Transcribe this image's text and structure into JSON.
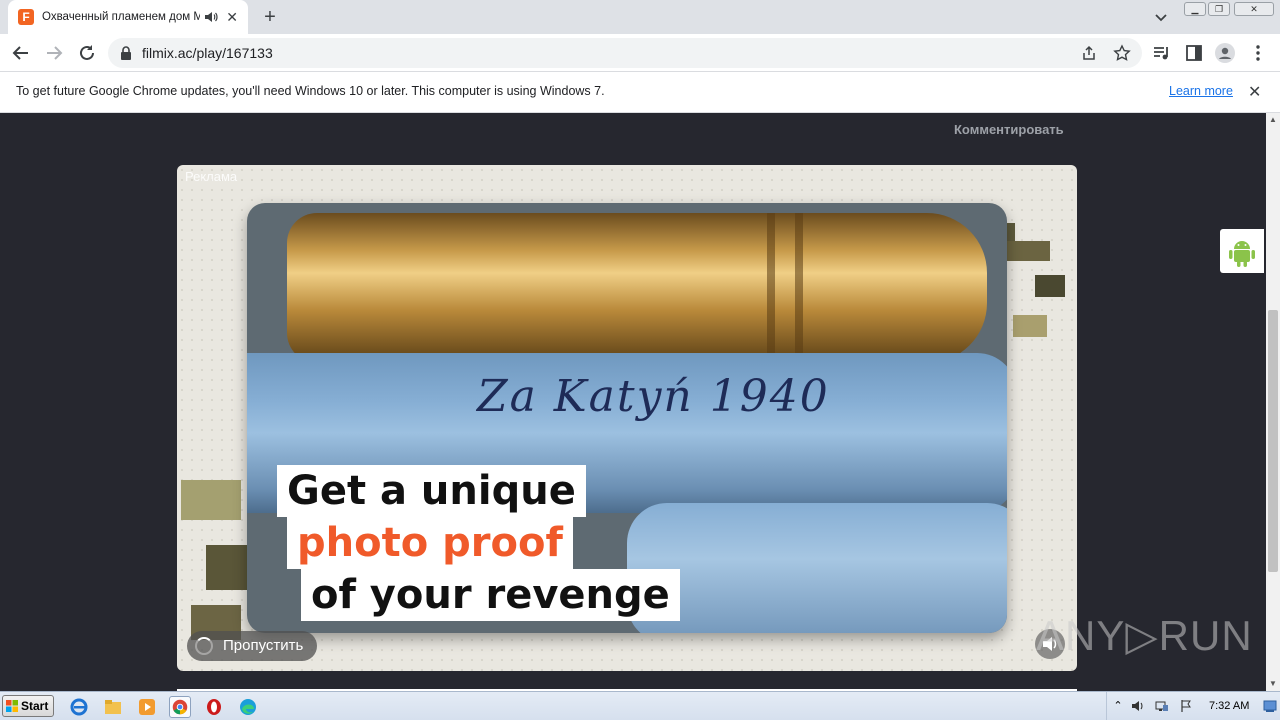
{
  "browser": {
    "tab": {
      "favicon_letter": "F",
      "title": "Охваченный пламенем дом Ма",
      "favicon_color": "#f26522"
    },
    "url": "filmix.ac/play/167133",
    "infobar": {
      "message": "To get future Google Chrome updates, you'll need Windows 10 or later. This computer is using Windows 7.",
      "link": "Learn more"
    }
  },
  "page": {
    "comment_link": "Комментировать",
    "ad": {
      "label": "Реклама",
      "scrawl": "Za Katyń 1940",
      "caption": [
        "Get a unique",
        "photo proof",
        "of your revenge"
      ],
      "caption_accent_color": "#f05a2a",
      "skip_label": "Пропустить"
    },
    "watermark": "ANY▷RUN"
  },
  "taskbar": {
    "start_label": "Start",
    "clock": "7:32 AM"
  }
}
